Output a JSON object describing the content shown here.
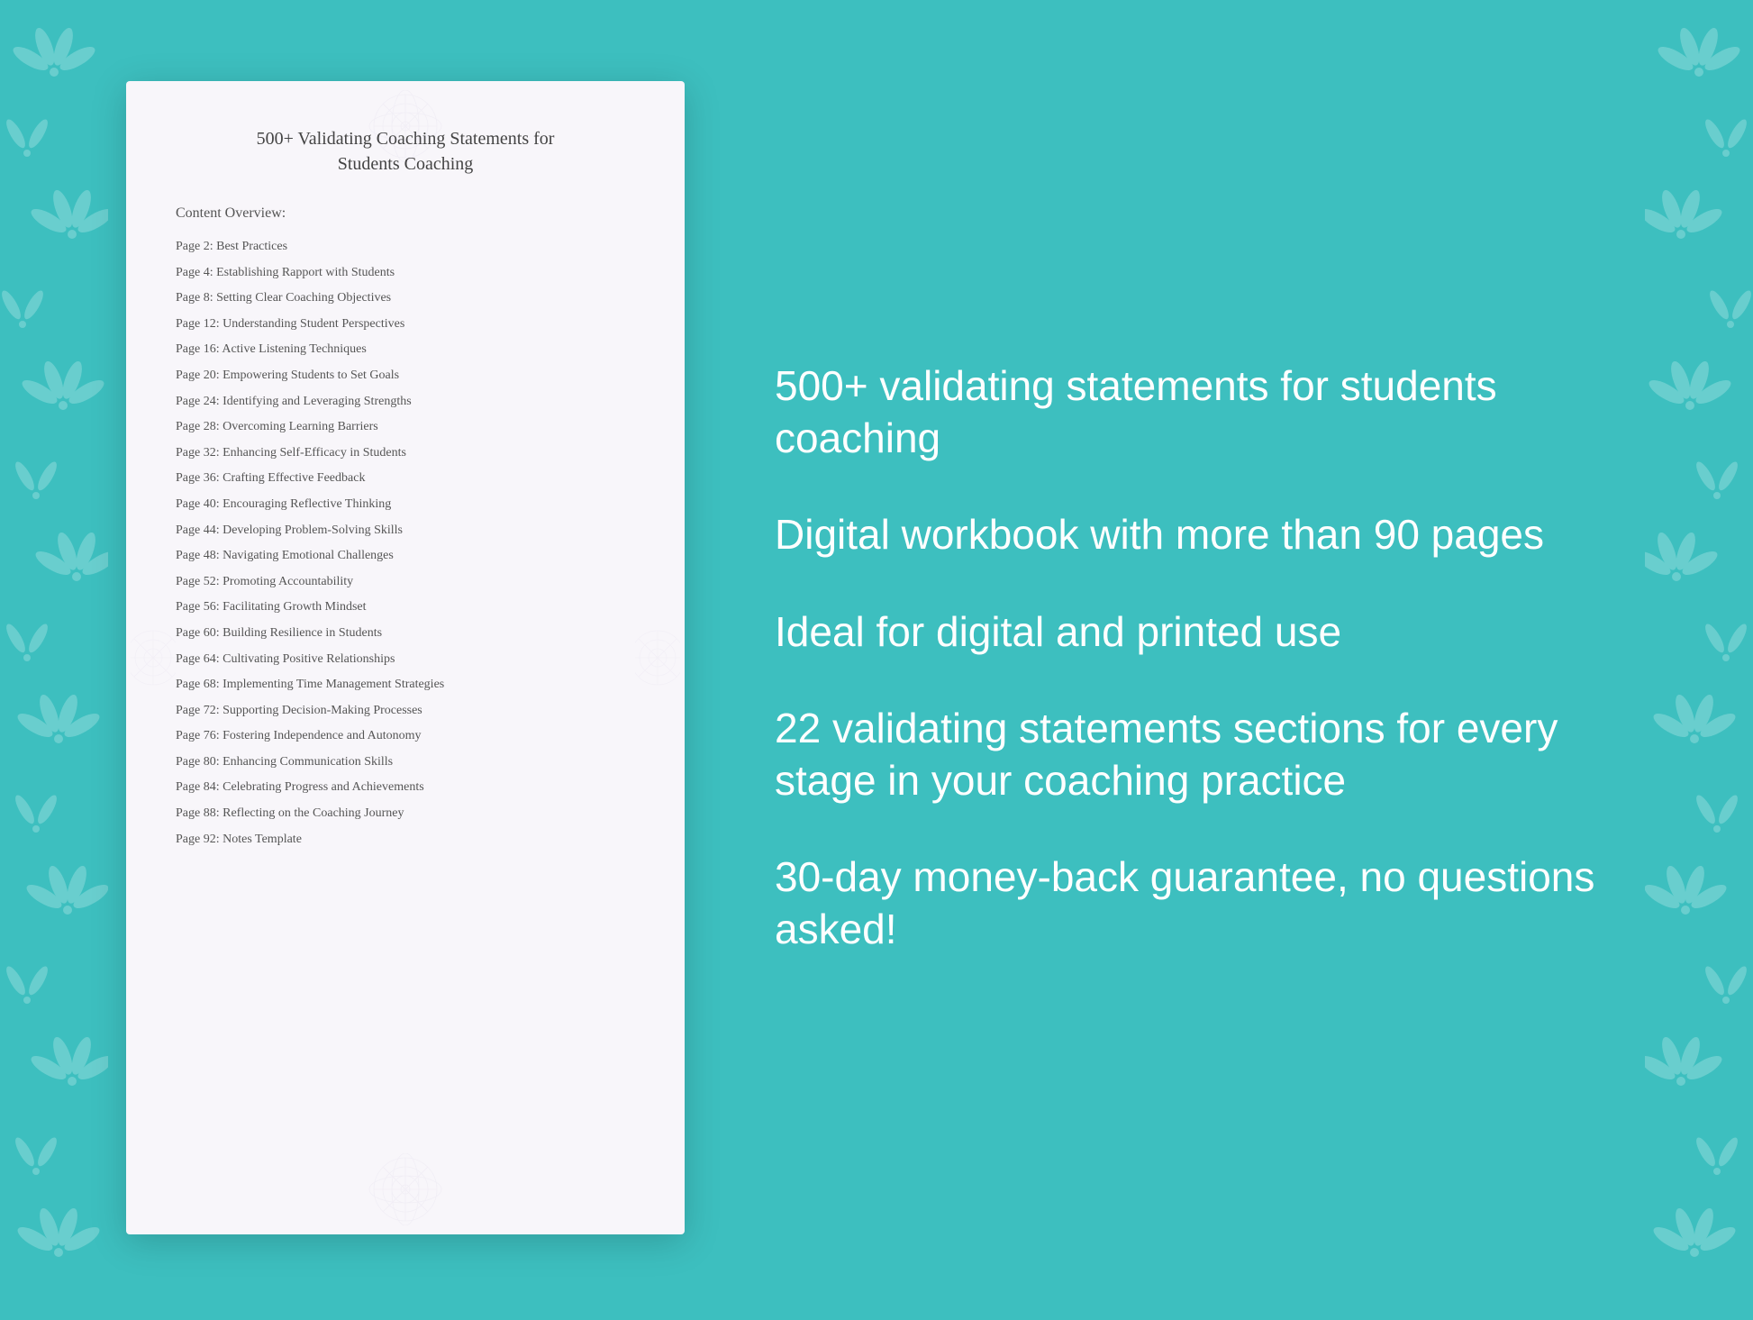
{
  "background": {
    "color": "#3dbfbf"
  },
  "document": {
    "title_line1": "500+ Validating Coaching Statements for",
    "title_line2": "Students Coaching",
    "content_overview_label": "Content Overview:",
    "toc_items": [
      {
        "page": "Page  2:",
        "topic": "Best Practices"
      },
      {
        "page": "Page  4:",
        "topic": "Establishing Rapport with Students"
      },
      {
        "page": "Page  8:",
        "topic": "Setting Clear Coaching Objectives"
      },
      {
        "page": "Page 12:",
        "topic": "Understanding Student Perspectives"
      },
      {
        "page": "Page 16:",
        "topic": "Active Listening Techniques"
      },
      {
        "page": "Page 20:",
        "topic": "Empowering Students to Set Goals"
      },
      {
        "page": "Page 24:",
        "topic": "Identifying and Leveraging Strengths"
      },
      {
        "page": "Page 28:",
        "topic": "Overcoming Learning Barriers"
      },
      {
        "page": "Page 32:",
        "topic": "Enhancing Self-Efficacy in Students"
      },
      {
        "page": "Page 36:",
        "topic": "Crafting Effective Feedback"
      },
      {
        "page": "Page 40:",
        "topic": "Encouraging Reflective Thinking"
      },
      {
        "page": "Page 44:",
        "topic": "Developing Problem-Solving Skills"
      },
      {
        "page": "Page 48:",
        "topic": "Navigating Emotional Challenges"
      },
      {
        "page": "Page 52:",
        "topic": "Promoting Accountability"
      },
      {
        "page": "Page 56:",
        "topic": "Facilitating Growth Mindset"
      },
      {
        "page": "Page 60:",
        "topic": "Building Resilience in Students"
      },
      {
        "page": "Page 64:",
        "topic": "Cultivating Positive Relationships"
      },
      {
        "page": "Page 68:",
        "topic": "Implementing Time Management Strategies"
      },
      {
        "page": "Page 72:",
        "topic": "Supporting Decision-Making Processes"
      },
      {
        "page": "Page 76:",
        "topic": "Fostering Independence and Autonomy"
      },
      {
        "page": "Page 80:",
        "topic": "Enhancing Communication Skills"
      },
      {
        "page": "Page 84:",
        "topic": "Celebrating Progress and Achievements"
      },
      {
        "page": "Page 88:",
        "topic": "Reflecting on the Coaching Journey"
      },
      {
        "page": "Page 92:",
        "topic": "Notes Template"
      }
    ]
  },
  "info_panel": {
    "blocks": [
      {
        "text": "500+ validating statements for students coaching"
      },
      {
        "text": "Digital workbook with more than 90 pages"
      },
      {
        "text": "Ideal for digital and printed use"
      },
      {
        "text": "22 validating statements sections for every stage in your coaching practice"
      },
      {
        "text": "30-day money-back guarantee, no questions asked!"
      }
    ]
  }
}
